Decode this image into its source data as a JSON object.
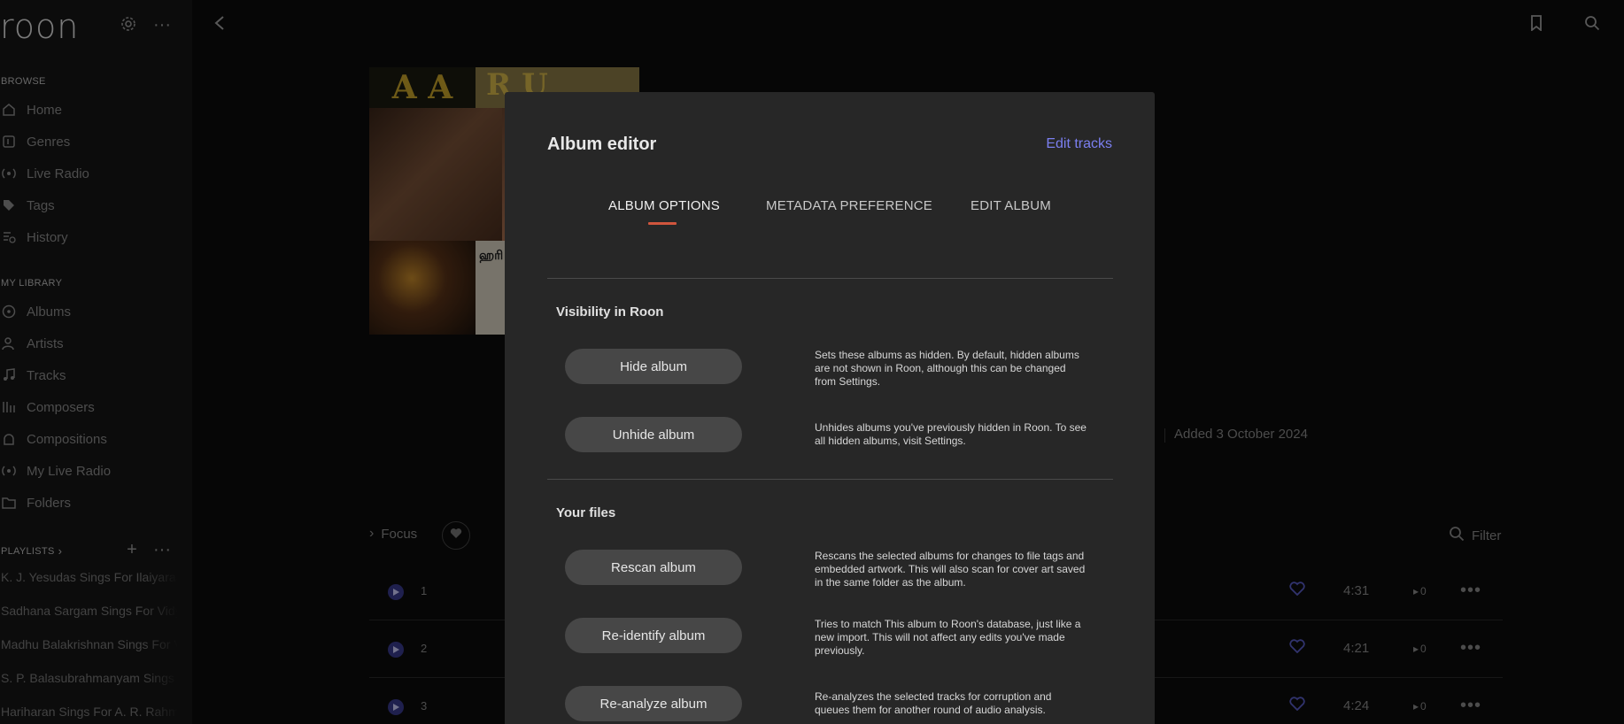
{
  "app": {
    "logo": "roon"
  },
  "sidebar": {
    "browse_label": "BROWSE",
    "browse_items": [
      {
        "label": "Home",
        "icon": "home-icon"
      },
      {
        "label": "Genres",
        "icon": "genres-icon"
      },
      {
        "label": "Live Radio",
        "icon": "radio-icon"
      },
      {
        "label": "Tags",
        "icon": "tag-icon"
      },
      {
        "label": "History",
        "icon": "history-icon"
      }
    ],
    "library_label": "MY LIBRARY",
    "library_items": [
      {
        "label": "Albums",
        "icon": "album-icon"
      },
      {
        "label": "Artists",
        "icon": "artist-icon"
      },
      {
        "label": "Tracks",
        "icon": "note-icon"
      },
      {
        "label": "Composers",
        "icon": "composer-icon"
      },
      {
        "label": "Compositions",
        "icon": "composition-icon"
      },
      {
        "label": "My Live Radio",
        "icon": "radio-icon"
      },
      {
        "label": "Folders",
        "icon": "folder-icon"
      }
    ],
    "playlists_label": "PLAYLISTS",
    "playlists": [
      "K. J. Yesudas Sings For Ilaiyaraaja",
      "Sadhana Sargam Sings For Vidyasagar",
      "Madhu Balakrishnan Sings For Vidyasagar",
      "S. P. Balasubrahmanyam Sings For Ilaiyaraaja",
      "Hariharan Sings For A. R. Rahman"
    ]
  },
  "album": {
    "cover_text_left": "A A",
    "cover_text_right": "R U",
    "cover_tamil": "ஹரி",
    "added": "Added 3 October 2024"
  },
  "toolbar": {
    "focus_label": "Focus",
    "filter_label": "Filter"
  },
  "tracks": [
    {
      "num": "1",
      "duration": "4:31",
      "plays": "0"
    },
    {
      "num": "2",
      "duration": "4:21",
      "plays": "0"
    },
    {
      "num": "3",
      "duration": "4:24",
      "plays": "0"
    }
  ],
  "modal": {
    "title": "Album editor",
    "edit_tracks": "Edit tracks",
    "tabs": [
      "ALBUM OPTIONS",
      "METADATA PREFERENCE",
      "EDIT ALBUM"
    ],
    "visibility": {
      "title": "Visibility in Roon",
      "hide_label": "Hide album",
      "hide_desc": "Sets these albums as hidden. By default, hidden albums are not shown in Roon, although this can be changed from Settings.",
      "unhide_label": "Unhide album",
      "unhide_desc": "Unhides albums you've previously hidden in Roon. To see all hidden albums, visit Settings."
    },
    "files": {
      "title": "Your files",
      "rescan_label": "Rescan album",
      "rescan_desc": "Rescans the selected albums for changes to file tags and embedded artwork. This will also scan for cover art saved in the same folder as the album.",
      "reidentify_label": "Re-identify album",
      "reidentify_desc": "Tries to match This album to Roon's database, just like a new import. This will not affect any edits you've made previously.",
      "reanalyze_label": "Re-analyze album",
      "reanalyze_desc": "Re-analyzes the selected tracks for corruption and queues them for another round of audio analysis."
    }
  },
  "colors": {
    "accent": "#7b7ff0",
    "tab_underline": "#d0553d",
    "play_button": "#3a3b8e"
  }
}
